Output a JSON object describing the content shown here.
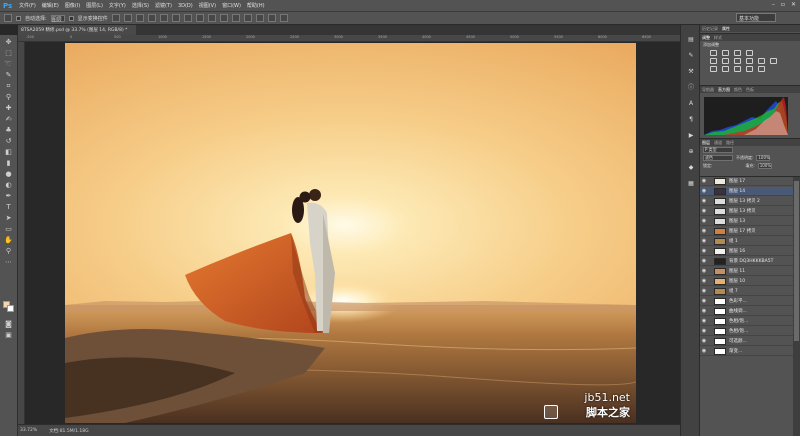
{
  "app": {
    "logo": "Ps"
  },
  "menubar": {
    "items": [
      "文件(F)",
      "编辑(E)",
      "图像(I)",
      "图层(L)",
      "文字(Y)",
      "选择(S)",
      "滤镜(T)",
      "3D(D)",
      "视图(V)",
      "窗口(W)",
      "帮助(H)"
    ],
    "window_controls": [
      "–",
      "▫",
      "✕"
    ]
  },
  "options": {
    "auto_select_label": "自动选择:",
    "auto_select_value": "图层",
    "show_transform_label": "显示变换控件",
    "workspace": "基本功能"
  },
  "document": {
    "tab_title": "8TSA2059 精修.psd @ 33.7% (图层 14, RGB/8) *",
    "zoom": "33.72%",
    "doc_size": "文档:81.5M/1.18G"
  },
  "ruler": {
    "top_ticks": [
      "-500",
      "0",
      "500",
      "1000",
      "1500",
      "2000",
      "2500",
      "3000",
      "3500",
      "4000",
      "4500",
      "5000",
      "5500",
      "6000",
      "6500"
    ]
  },
  "panels": {
    "top_tabs": [
      "历史记录",
      "属性"
    ],
    "adjust_tabs": [
      "调整",
      "样式"
    ],
    "adjust_title": "添加调整",
    "histo_tabs": [
      "导航器",
      "直方图",
      "颜色",
      "色板"
    ],
    "layers_tabs": [
      "图层",
      "通道",
      "路径"
    ],
    "kind_select": "P 类型",
    "blend_mode": "滤色",
    "opacity_label": "不透明度:",
    "opacity_value": "100%",
    "lock_label": "锁定:",
    "fill_label": "填充:",
    "fill_value": "100%"
  },
  "layers": [
    {
      "name": "图层 17",
      "selected": false,
      "thumb": "#f2ead8"
    },
    {
      "name": "图层 14",
      "selected": true,
      "thumb": "#3c3040"
    },
    {
      "name": "图层 13 拷贝 2",
      "selected": false,
      "thumb": "#dddddd"
    },
    {
      "name": "图层 13 拷贝",
      "selected": false,
      "thumb": "#dddddd"
    },
    {
      "name": "图层 13",
      "selected": false,
      "thumb": "#dddddd"
    },
    {
      "name": "图层 17 拷贝",
      "selected": false,
      "thumb": "#d08040"
    },
    {
      "name": "组 1",
      "selected": false,
      "thumb": "#b38a52"
    },
    {
      "name": "图层 16",
      "selected": false,
      "thumb": "#f2f2f2"
    },
    {
      "name": "背景 DQ3HKKKBA5T",
      "selected": false,
      "thumb": "#222222"
    },
    {
      "name": "图层 11",
      "selected": false,
      "thumb": "#c89060"
    },
    {
      "name": "图层 10",
      "selected": false,
      "thumb": "#e8b070"
    },
    {
      "name": "组 7",
      "selected": false,
      "thumb": "#b38a52"
    },
    {
      "name": "色彩平...",
      "selected": false,
      "thumb": "#ffffff"
    },
    {
      "name": "曲线调...",
      "selected": false,
      "thumb": "#ffffff"
    },
    {
      "name": "色相/饱...",
      "selected": false,
      "thumb": "#ffffff"
    },
    {
      "name": "色相/饱...",
      "selected": false,
      "thumb": "#ffffff"
    },
    {
      "name": "可选颜...",
      "selected": false,
      "thumb": "#ffffff"
    },
    {
      "name": "渐变...",
      "selected": false,
      "thumb": "#ffffff"
    }
  ],
  "watermark": {
    "site": "jb51.net",
    "name": "脚本之家"
  },
  "colors": {
    "ui_bg": "#535353",
    "dark": "#282828",
    "accent": "#31a8ff",
    "selected": "#4a5a76"
  }
}
